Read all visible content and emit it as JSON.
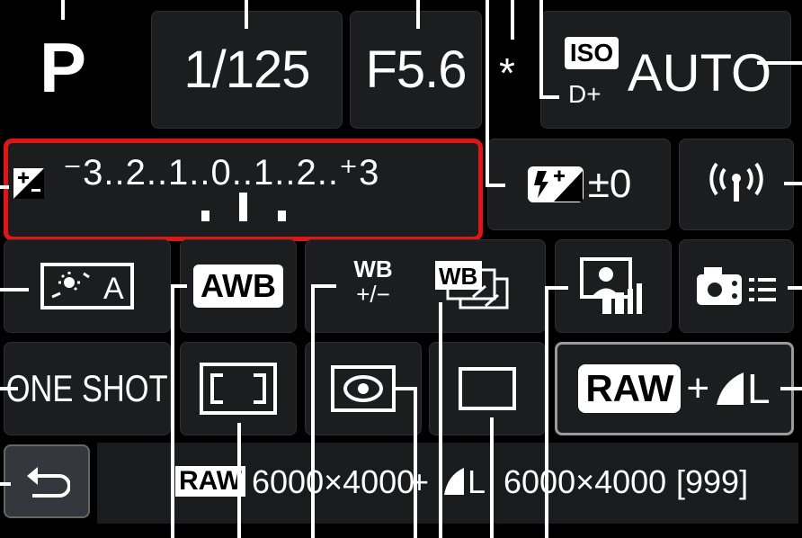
{
  "screen": {
    "shooting_mode": "P",
    "shutter_speed": "1/125",
    "aperture": "F5.6",
    "ae_lock": "*",
    "iso_label": "ISO",
    "highlight_tone_priority": "D+",
    "iso_value": "AUTO"
  },
  "exposure_comp": {
    "scale": "⁻3..2..1..0..1..2..⁺3",
    "highlighted_color": "#e01515"
  },
  "flash_comp": {
    "value": "±0"
  },
  "wb": {
    "awb_label": "AWB",
    "shift_label_top": "WB",
    "shift_label_bottom": "+/−",
    "bracket_label": "WB"
  },
  "picture_style": {
    "auto_label": "A"
  },
  "af": {
    "operation": "ONE SHOT"
  },
  "quality": {
    "raw_label": "RAW",
    "plus": "+",
    "jpeg_size": "L"
  },
  "bottom_bar": {
    "raw_tag": "RAW",
    "raw_resolution": "6000×4000",
    "sep": "+",
    "jpeg_size": "L",
    "jpeg_resolution": "6000×4000",
    "shots_remaining": "[999]"
  },
  "icons": [
    "exposure-comp-icon",
    "flash-exposure-comp-icon",
    "wireless-icon",
    "auto-lighting-optimizer-icon",
    "white-balance-icon",
    "wb-shift-icon",
    "wb-bracket-icon",
    "picture-style-icon",
    "custom-controls-icon",
    "af-area-icon",
    "metering-mode-icon",
    "drive-mode-icon",
    "back-icon"
  ]
}
